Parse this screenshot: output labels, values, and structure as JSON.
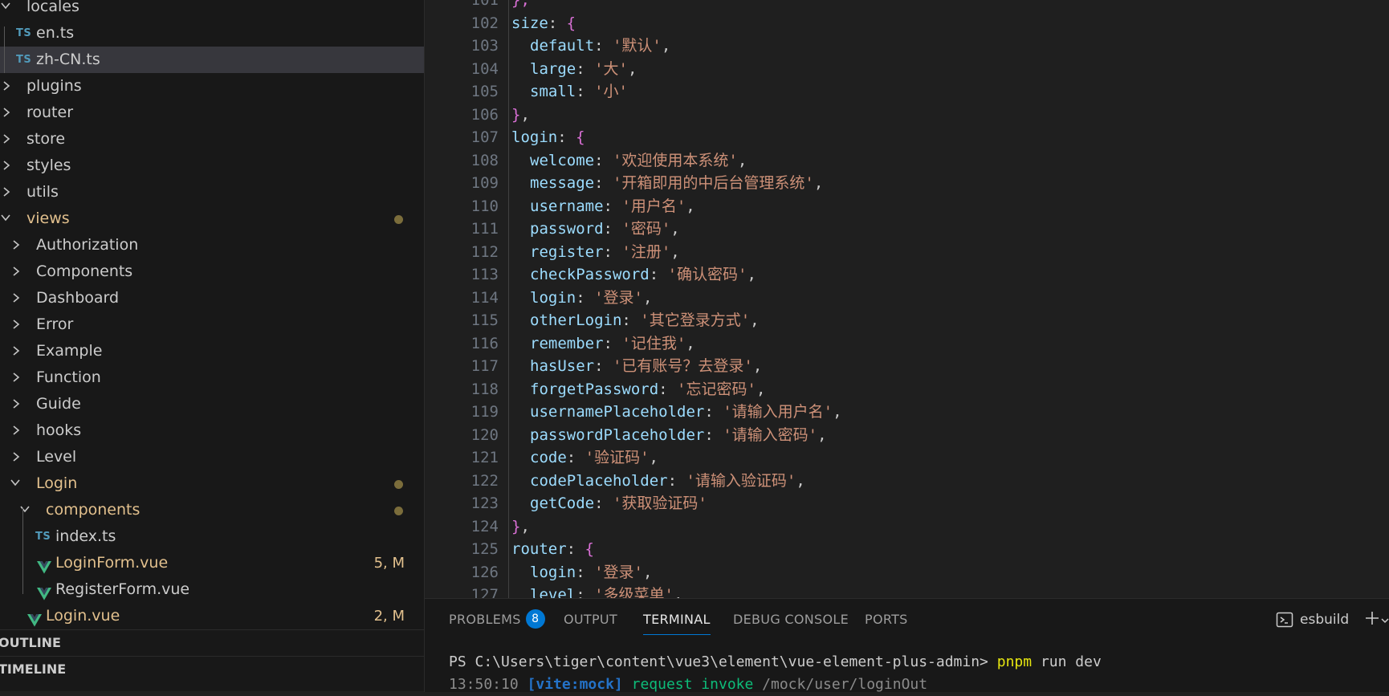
{
  "explorer": {
    "items": [
      {
        "label": "locales",
        "kind": "folder-open",
        "depth": 0
      },
      {
        "label": "en.ts",
        "kind": "ts",
        "depth": 1
      },
      {
        "label": "zh-CN.ts",
        "kind": "ts",
        "depth": 1,
        "selected": true
      },
      {
        "label": "plugins",
        "kind": "folder",
        "depth": 0
      },
      {
        "label": "router",
        "kind": "folder",
        "depth": 0
      },
      {
        "label": "store",
        "kind": "folder",
        "depth": 0
      },
      {
        "label": "styles",
        "kind": "folder",
        "depth": 0
      },
      {
        "label": "utils",
        "kind": "folder",
        "depth": 0
      },
      {
        "label": "views",
        "kind": "folder-open",
        "depth": 0,
        "modified": true,
        "dot": true
      },
      {
        "label": "Authorization",
        "kind": "folder",
        "depth": 1
      },
      {
        "label": "Components",
        "kind": "folder",
        "depth": 1
      },
      {
        "label": "Dashboard",
        "kind": "folder",
        "depth": 1
      },
      {
        "label": "Error",
        "kind": "folder",
        "depth": 1
      },
      {
        "label": "Example",
        "kind": "folder",
        "depth": 1
      },
      {
        "label": "Function",
        "kind": "folder",
        "depth": 1
      },
      {
        "label": "Guide",
        "kind": "folder",
        "depth": 1
      },
      {
        "label": "hooks",
        "kind": "folder",
        "depth": 1
      },
      {
        "label": "Level",
        "kind": "folder",
        "depth": 1
      },
      {
        "label": "Login",
        "kind": "folder-open",
        "depth": 1,
        "modified": true,
        "dot": true
      },
      {
        "label": "components",
        "kind": "folder-open",
        "depth": 2,
        "modified": true,
        "dot": true
      },
      {
        "label": "index.ts",
        "kind": "ts",
        "depth": 3
      },
      {
        "label": "LoginForm.vue",
        "kind": "vue",
        "depth": 3,
        "modified": true,
        "badge": "5, M"
      },
      {
        "label": "RegisterForm.vue",
        "kind": "vue",
        "depth": 3
      },
      {
        "label": "Login.vue",
        "kind": "vue",
        "depth": 2,
        "modified": true,
        "badge": "2, M"
      }
    ],
    "sections": {
      "outline": "OUTLINE",
      "timeline": "TIMELINE"
    }
  },
  "editor": {
    "lines": [
      {
        "n": "101",
        "indent": 1,
        "tokens": [
          [
            "b",
            "},"
          ]
        ]
      },
      {
        "n": "102",
        "indent": 1,
        "tokens": [
          [
            "k",
            "size"
          ],
          [
            "p",
            ": "
          ],
          [
            "b",
            "{"
          ]
        ]
      },
      {
        "n": "103",
        "indent": 2,
        "tokens": [
          [
            "k",
            "default"
          ],
          [
            "p",
            ": "
          ],
          [
            "s",
            "'默认'"
          ],
          [
            "p",
            ","
          ]
        ]
      },
      {
        "n": "104",
        "indent": 2,
        "tokens": [
          [
            "k",
            "large"
          ],
          [
            "p",
            ": "
          ],
          [
            "s",
            "'大'"
          ],
          [
            "p",
            ","
          ]
        ]
      },
      {
        "n": "105",
        "indent": 2,
        "tokens": [
          [
            "k",
            "small"
          ],
          [
            "p",
            ": "
          ],
          [
            "s",
            "'小'"
          ]
        ]
      },
      {
        "n": "106",
        "indent": 1,
        "tokens": [
          [
            "b",
            "}"
          ],
          [
            "p",
            ","
          ]
        ]
      },
      {
        "n": "107",
        "indent": 1,
        "tokens": [
          [
            "k",
            "login"
          ],
          [
            "p",
            ": "
          ],
          [
            "b",
            "{"
          ]
        ]
      },
      {
        "n": "108",
        "indent": 2,
        "tokens": [
          [
            "k",
            "welcome"
          ],
          [
            "p",
            ": "
          ],
          [
            "s",
            "'欢迎使用本系统'"
          ],
          [
            "p",
            ","
          ]
        ]
      },
      {
        "n": "109",
        "indent": 2,
        "tokens": [
          [
            "k",
            "message"
          ],
          [
            "p",
            ": "
          ],
          [
            "s",
            "'开箱即用的中后台管理系统'"
          ],
          [
            "p",
            ","
          ]
        ]
      },
      {
        "n": "110",
        "indent": 2,
        "tokens": [
          [
            "k",
            "username"
          ],
          [
            "p",
            ": "
          ],
          [
            "s",
            "'用户名'"
          ],
          [
            "p",
            ","
          ]
        ]
      },
      {
        "n": "111",
        "indent": 2,
        "tokens": [
          [
            "k",
            "password"
          ],
          [
            "p",
            ": "
          ],
          [
            "s",
            "'密码'"
          ],
          [
            "p",
            ","
          ]
        ]
      },
      {
        "n": "112",
        "indent": 2,
        "tokens": [
          [
            "k",
            "register"
          ],
          [
            "p",
            ": "
          ],
          [
            "s",
            "'注册'"
          ],
          [
            "p",
            ","
          ]
        ]
      },
      {
        "n": "113",
        "indent": 2,
        "tokens": [
          [
            "k",
            "checkPassword"
          ],
          [
            "p",
            ": "
          ],
          [
            "s",
            "'确认密码'"
          ],
          [
            "p",
            ","
          ]
        ]
      },
      {
        "n": "114",
        "indent": 2,
        "tokens": [
          [
            "k",
            "login"
          ],
          [
            "p",
            ": "
          ],
          [
            "s",
            "'登录'"
          ],
          [
            "p",
            ","
          ]
        ]
      },
      {
        "n": "115",
        "indent": 2,
        "tokens": [
          [
            "k",
            "otherLogin"
          ],
          [
            "p",
            ": "
          ],
          [
            "s",
            "'其它登录方式'"
          ],
          [
            "p",
            ","
          ]
        ]
      },
      {
        "n": "116",
        "indent": 2,
        "tokens": [
          [
            "k",
            "remember"
          ],
          [
            "p",
            ": "
          ],
          [
            "s",
            "'记住我'"
          ],
          [
            "p",
            ","
          ]
        ]
      },
      {
        "n": "117",
        "indent": 2,
        "tokens": [
          [
            "k",
            "hasUser"
          ],
          [
            "p",
            ": "
          ],
          [
            "s",
            "'已有账号？去登录'"
          ],
          [
            "p",
            ","
          ]
        ]
      },
      {
        "n": "118",
        "indent": 2,
        "tokens": [
          [
            "k",
            "forgetPassword"
          ],
          [
            "p",
            ": "
          ],
          [
            "s",
            "'忘记密码'"
          ],
          [
            "p",
            ","
          ]
        ]
      },
      {
        "n": "119",
        "indent": 2,
        "tokens": [
          [
            "k",
            "usernamePlaceholder"
          ],
          [
            "p",
            ": "
          ],
          [
            "s",
            "'请输入用户名'"
          ],
          [
            "p",
            ","
          ]
        ]
      },
      {
        "n": "120",
        "indent": 2,
        "tokens": [
          [
            "k",
            "passwordPlaceholder"
          ],
          [
            "p",
            ": "
          ],
          [
            "s",
            "'请输入密码'"
          ],
          [
            "p",
            ","
          ]
        ]
      },
      {
        "n": "121",
        "indent": 2,
        "tokens": [
          [
            "k",
            "code"
          ],
          [
            "p",
            ": "
          ],
          [
            "s",
            "'验证码'"
          ],
          [
            "p",
            ","
          ]
        ]
      },
      {
        "n": "122",
        "indent": 2,
        "tokens": [
          [
            "k",
            "codePlaceholder"
          ],
          [
            "p",
            ": "
          ],
          [
            "s",
            "'请输入验证码'"
          ],
          [
            "p",
            ","
          ]
        ]
      },
      {
        "n": "123",
        "indent": 2,
        "tokens": [
          [
            "k",
            "getCode"
          ],
          [
            "p",
            ": "
          ],
          [
            "s",
            "'获取验证码'"
          ]
        ]
      },
      {
        "n": "124",
        "indent": 1,
        "tokens": [
          [
            "b",
            "}"
          ],
          [
            "p",
            ","
          ]
        ]
      },
      {
        "n": "125",
        "indent": 1,
        "tokens": [
          [
            "k",
            "router"
          ],
          [
            "p",
            ": "
          ],
          [
            "b",
            "{"
          ]
        ]
      },
      {
        "n": "126",
        "indent": 2,
        "tokens": [
          [
            "k",
            "login"
          ],
          [
            "p",
            ": "
          ],
          [
            "s",
            "'登录'"
          ],
          [
            "p",
            ","
          ]
        ]
      },
      {
        "n": "127",
        "indent": 2,
        "tokens": [
          [
            "k",
            "level"
          ],
          [
            "p",
            ": "
          ],
          [
            "s",
            "'多级菜单'"
          ],
          [
            "p",
            ","
          ]
        ]
      }
    ]
  },
  "panel": {
    "tabs": {
      "problems": "PROBLEMS",
      "problems_count": "8",
      "output": "OUTPUT",
      "terminal": "TERMINAL",
      "debug": "DEBUG CONSOLE",
      "ports": "PORTS"
    },
    "terminal_profile": "esbuild",
    "terminal": {
      "prompt": "PS C:\\Users\\tiger\\content\\vue3\\element\\vue-element-plus-admin>",
      "cmd": "pnpm",
      "args": "run dev",
      "time": "13:50:10",
      "tag": "[vite:mock]",
      "action": "request invoke",
      "path": "/mock/user/loginOut"
    }
  },
  "colors": {
    "accent": "#0078d4",
    "modified": "#e2c08d",
    "ts_icon": "#519aba",
    "vue_icon": "#41b883"
  }
}
